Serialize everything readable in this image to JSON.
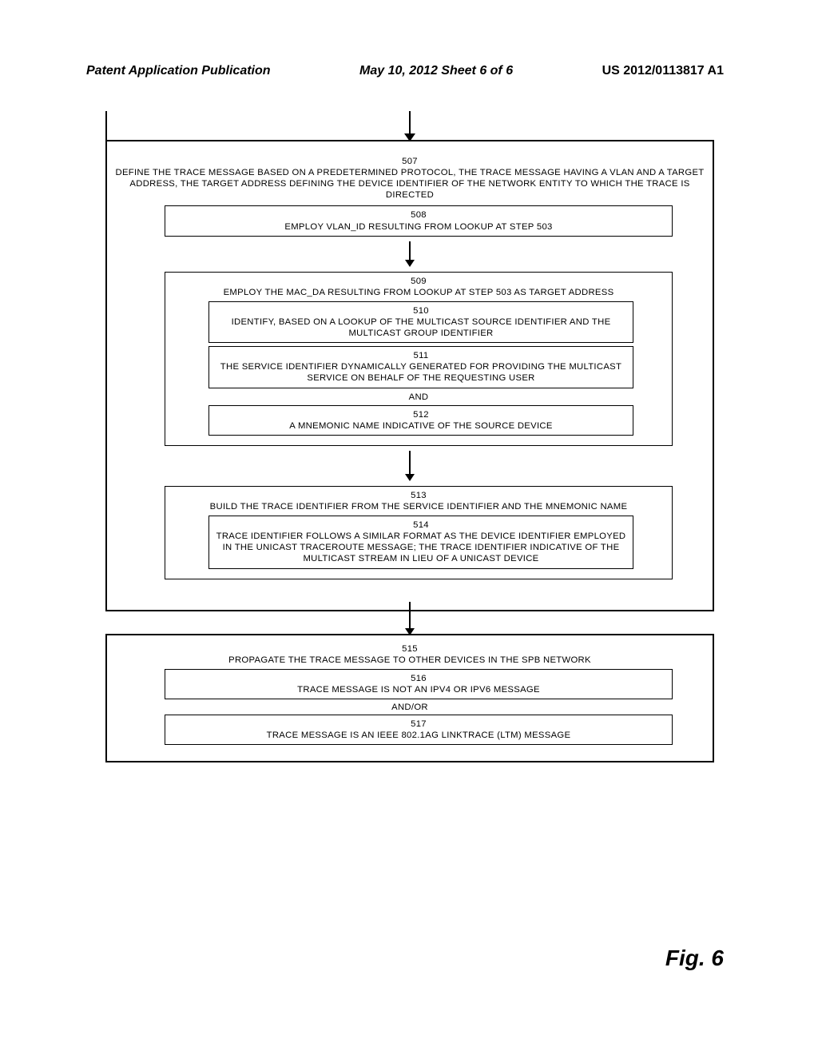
{
  "header": {
    "left": "Patent Application Publication",
    "center": "May 10, 2012  Sheet 6 of 6",
    "right": "US 2012/0113817 A1"
  },
  "figure_label": "Fig. 6",
  "steps": {
    "s507": {
      "num": "507",
      "text": "DEFINE THE TRACE MESSAGE BASED ON A PREDETERMINED PROTOCOL, THE TRACE MESSAGE HAVING A  VLAN AND A TARGET ADDRESS, THE TARGET ADDRESS DEFINING THE DEVICE IDENTIFIER OF THE NETWORK ENTITY TO WHICH THE TRACE IS  DIRECTED"
    },
    "s508": {
      "num": "508",
      "text": "EMPLOY VLAN_ID RESULTING FROM LOOKUP AT STEP 503"
    },
    "s509": {
      "num": "509",
      "text": "EMPLOY THE MAC_DA RESULTING FROM LOOKUP AT STEP 503 AS TARGET ADDRESS"
    },
    "s510": {
      "num": "510",
      "text": "IDENTIFY, BASED ON A LOOKUP OF THE MULTICAST SOURCE IDENTIFIER AND THE MULTICAST GROUP IDENTIFIER"
    },
    "s511": {
      "num": "511",
      "text": "THE SERVICE IDENTIFIER DYNAMICALLY GENERATED FOR PROVIDING THE MULTICAST SERVICE ON BEHALF OF THE REQUESTING USER"
    },
    "and1": "AND",
    "s512": {
      "num": "512",
      "text": "A MNEMONIC NAME INDICATIVE OF THE SOURCE DEVICE"
    },
    "s513": {
      "num": "513",
      "text": "BUILD THE TRACE IDENTIFIER FROM THE SERVICE IDENTIFIER AND THE MNEMONIC NAME"
    },
    "s514": {
      "num": "514",
      "text": "TRACE IDENTIFIER FOLLOWS A SIMILAR FORMAT AS THE DEVICE IDENTIFIER EMPLOYED IN THE UNICAST TRACEROUTE MESSAGE; THE TRACE IDENTIFIER INDICATIVE OF THE MULTICAST STREAM IN LIEU OF A UNICAST DEVICE"
    },
    "s515": {
      "num": "515",
      "text": "PROPAGATE THE TRACE MESSAGE TO OTHER DEVICES IN THE SPB NETWORK"
    },
    "s516": {
      "num": "516",
      "text": "TRACE MESSAGE IS NOT AN IPV4 OR IPV6 MESSAGE"
    },
    "andor": "AND/OR",
    "s517": {
      "num": "517",
      "text": "TRACE MESSAGE IS AN IEEE 802.1AG LINKTRACE (LTM) MESSAGE"
    }
  }
}
